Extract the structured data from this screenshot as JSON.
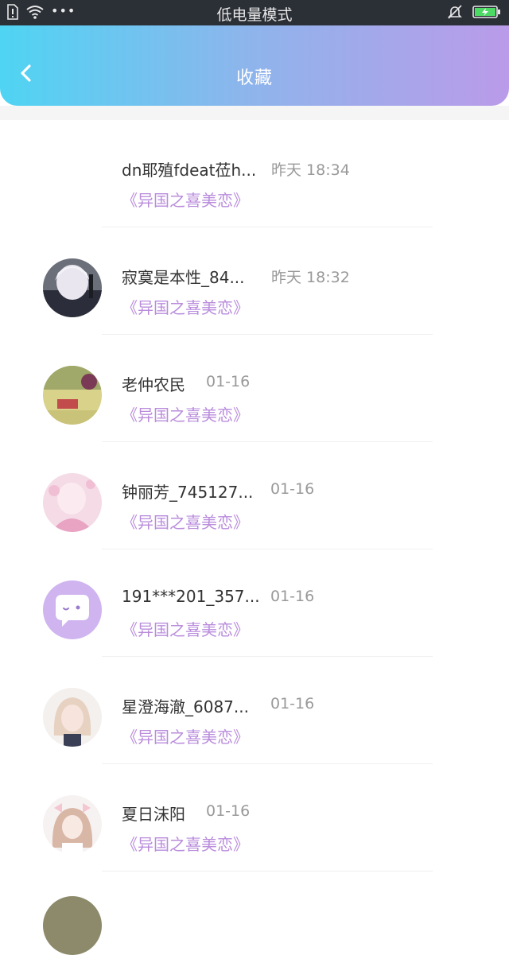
{
  "status_bar": {
    "title": "低电量模式",
    "dots": "•••"
  },
  "header": {
    "title": "收藏"
  },
  "items": [
    {
      "name": "dn耶殖fdeat莅h...",
      "time": "昨天 18:34",
      "book": "《异国之喜美恋》",
      "avatar": "none"
    },
    {
      "name": "寂寞是本性_84...",
      "time": "昨天 18:32",
      "book": "《异国之喜美恋》",
      "avatar": "photo-anime-boy"
    },
    {
      "name": "老仲农民",
      "time": "01-16",
      "book": "《异国之喜美恋》",
      "avatar": "photo-scene"
    },
    {
      "name": "钟丽芳_745127...",
      "time": "01-16",
      "book": "《异国之喜美恋》",
      "avatar": "photo-pink-anime"
    },
    {
      "name": "191***201_357...",
      "time": "01-16",
      "book": "《异国之喜美恋》",
      "avatar": "default-chat-bubble"
    },
    {
      "name": "星澄海澈_6087...",
      "time": "01-16",
      "book": "《异国之喜美恋》",
      "avatar": "photo-anime-girl"
    },
    {
      "name": "夏日沫阳",
      "time": "01-16",
      "book": "《异国之喜美恋》",
      "avatar": "photo-anime-girl-bow"
    }
  ],
  "colors": {
    "accent_purple": "#b98cdc",
    "header_start": "#4fd4f3",
    "header_end": "#ba9be9"
  }
}
